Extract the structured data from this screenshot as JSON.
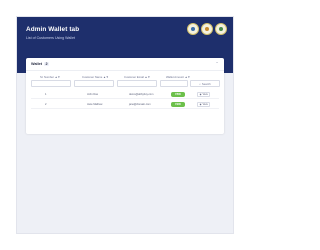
{
  "header": {
    "title": "Admin Wallet tab",
    "subtitle": "List of Customers Using Wallet",
    "logos": [
      "emblem-seal-1",
      "emblem-seal-2",
      "emblem-seal-3"
    ]
  },
  "wallet_card": {
    "title": "Wallet",
    "count": "2",
    "columns": [
      "Sl. Number ▲▼",
      "Customer Name ▲▼",
      "Customer Email ▲▼",
      "Wallet Amount ▲▼"
    ],
    "search_label": "Search",
    "rows": [
      {
        "sl": "1",
        "name": "John Doe",
        "email": "demo@abbyboy.com",
        "amount": "₹500",
        "action": "View"
      },
      {
        "sl": "2",
        "name": "Jane Mathew",
        "email": "jane@domain.com",
        "amount": "₹200",
        "action": "View"
      }
    ]
  },
  "colors": {
    "header_bg": "#1e2f6c",
    "page_bg": "#eef0f6",
    "status_green": "#6cc04a"
  }
}
